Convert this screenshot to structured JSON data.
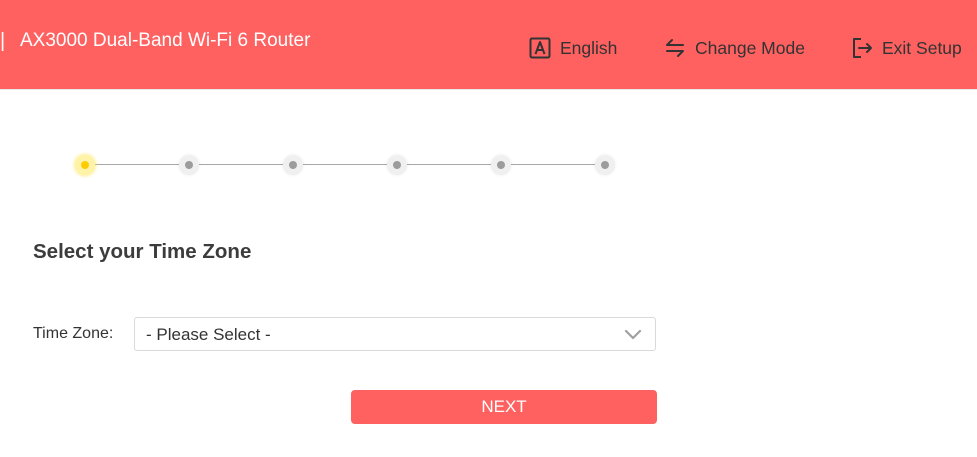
{
  "header": {
    "separator": "|",
    "title": "AX3000 Dual-Band Wi-Fi 6 Router",
    "language_label": "English",
    "change_mode_label": "Change Mode",
    "exit_label": "Exit Setup",
    "background_color": "#ff6060"
  },
  "stepper": {
    "total_steps": 6,
    "current_step": 1,
    "active_color": "#ffcc00"
  },
  "main": {
    "heading": "Select your Time Zone",
    "time_zone_label": "Time Zone:",
    "time_zone_value": "- Please Select -",
    "next_label": "NEXT"
  }
}
